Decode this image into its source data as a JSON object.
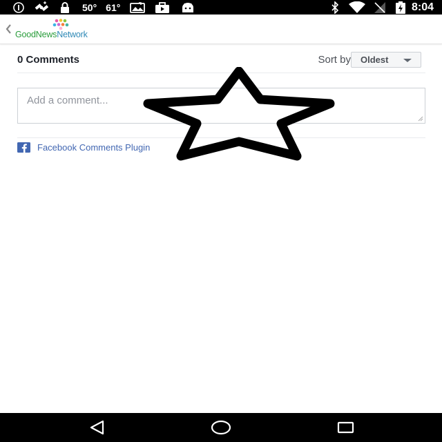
{
  "status_bar": {
    "temp_1": "50°",
    "temp_2": "61°",
    "time": "8:04",
    "icons": [
      "info-icon",
      "satellite-icon",
      "lock-icon",
      "photo-icon",
      "briefcase-icon",
      "android-icon",
      "bluetooth-icon",
      "wifi-icon",
      "no-signal-icon",
      "battery-charging-icon"
    ]
  },
  "header": {
    "logo": {
      "part1": "Good",
      "part2": "News",
      "part3": "Network"
    },
    "back_icon": "chevron-left-icon"
  },
  "comments": {
    "count_label": "0 Comments",
    "sort_by_label": "Sort by",
    "sort_value": "Oldest",
    "input_placeholder": "Add a comment...",
    "plugin_link": "Facebook Comments Plugin"
  },
  "overlay": {
    "icon": "star-outline-icon"
  },
  "nav_bar": {
    "icons": [
      "back-triangle-icon",
      "home-circle-icon",
      "recents-square-icon"
    ]
  },
  "colors": {
    "bar": "#000000",
    "brand_green": "#2b9d3c",
    "brand_blue": "#2f89b6",
    "facebook_blue": "#4267b2",
    "text_dark": "#1d2129",
    "text_muted": "#90949c"
  }
}
